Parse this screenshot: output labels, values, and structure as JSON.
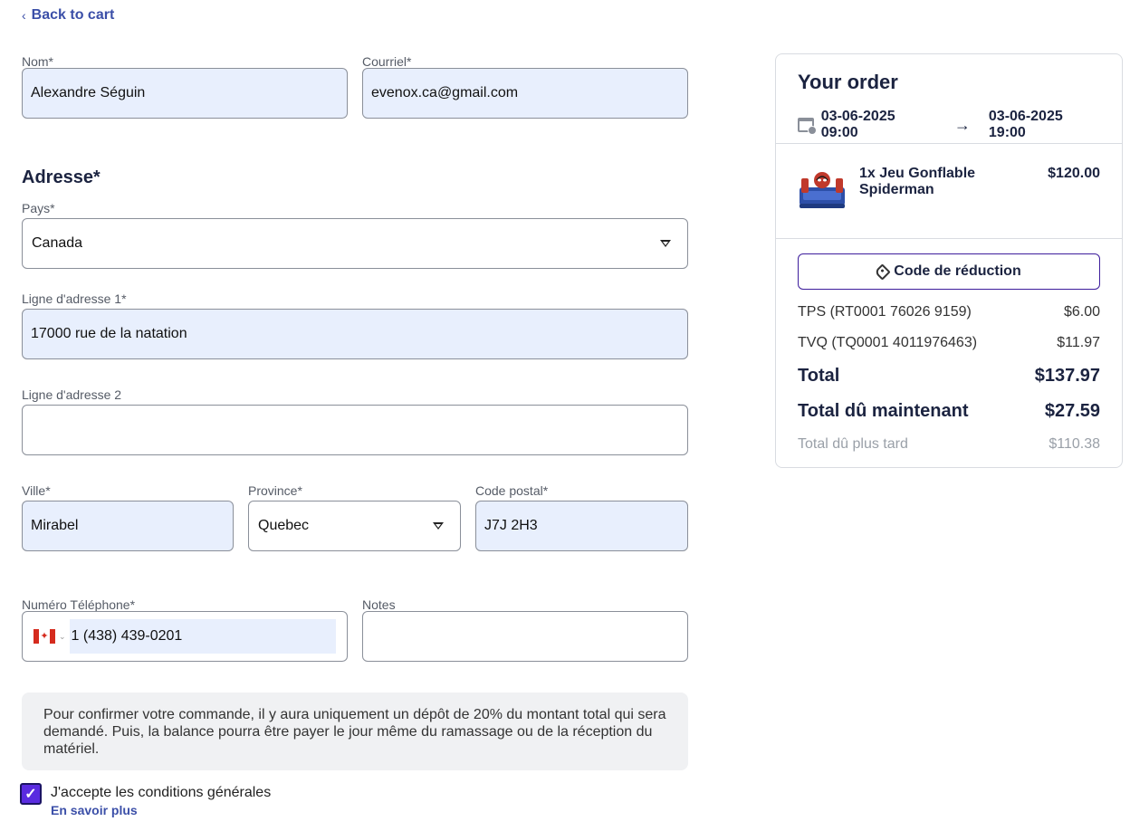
{
  "nav": {
    "back_label": "Back to cart"
  },
  "form": {
    "name": {
      "label": "Nom*",
      "value": "Alexandre Séguin"
    },
    "email": {
      "label": "Courriel*",
      "value": "evenox.ca@gmail.com"
    },
    "address_title": "Adresse*",
    "country": {
      "label": "Pays*",
      "value": "Canada"
    },
    "address1": {
      "label": "Ligne d'adresse 1*",
      "value": "17000 rue de la natation"
    },
    "address2": {
      "label": "Ligne d'adresse 2",
      "value": ""
    },
    "city": {
      "label": "Ville*",
      "value": "Mirabel"
    },
    "province": {
      "label": "Province*",
      "value": "Quebec"
    },
    "postal": {
      "label": "Code postal*",
      "value": "J7J 2H3"
    },
    "phone": {
      "label": "Numéro Téléphone*",
      "value": "1 (438) 439-0201"
    },
    "notes": {
      "label": "Notes",
      "value": ""
    },
    "notice": "Pour confirmer votre commande, il y aura uniquement un dépôt de 20% du montant total qui sera demandé. Puis, la balance pourra être payer le jour même du ramassage ou de la réception du matériel.",
    "terms": {
      "label": "J'accepte les conditions générales",
      "checked": true,
      "learn_more": "En savoir plus"
    }
  },
  "order": {
    "title": "Your order",
    "start": "03-06-2025 09:00",
    "end": "03-06-2025 19:00",
    "item": {
      "name": "1x Jeu Gonflable Spiderman",
      "price": "$120.00"
    },
    "discount_label": "Code de réduction",
    "taxes": [
      {
        "label": "TPS (RT0001 76026 9159)",
        "value": "$6.00"
      },
      {
        "label": "TVQ (TQ0001 4011976463)",
        "value": "$11.97"
      }
    ],
    "total": {
      "label": "Total",
      "value": "$137.97"
    },
    "due_now": {
      "label": "Total dû maintenant",
      "value": "$27.59"
    },
    "due_later": {
      "label": "Total dû plus tard",
      "value": "$110.38"
    }
  },
  "colors": {
    "accent": "#3b4fa8",
    "filled_field": "#e8effd",
    "checkbox": "#5a2be0"
  }
}
